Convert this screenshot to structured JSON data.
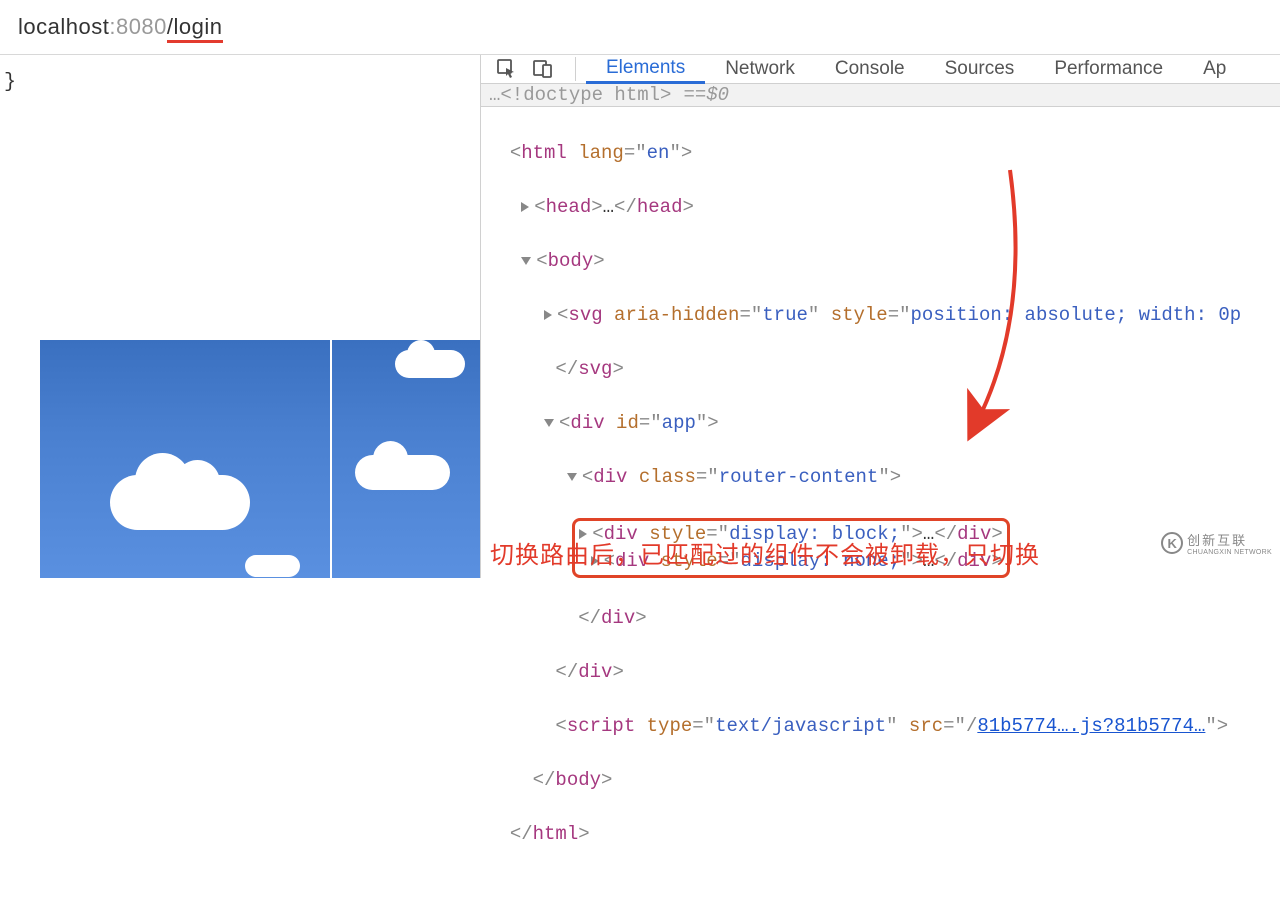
{
  "url": {
    "host": "localhost",
    "port": ":8080",
    "path": "/login"
  },
  "left": {
    "bracket": "}"
  },
  "tabs": {
    "elements": "Elements",
    "network": "Network",
    "console": "Console",
    "sources": "Sources",
    "performance": "Performance",
    "app_cut": "Ap"
  },
  "breadcrumb": {
    "ellipsis": "…",
    "doctype": "<!doctype html>",
    "eq": " == ",
    "dollar": "$0"
  },
  "dom": {
    "html_open": "<",
    "html_tag": "html",
    "html_attr": " lang",
    "html_eq": "=\"",
    "html_val": "en",
    "html_close": "\">",
    "head_open": "<",
    "head_tag": "head",
    "head_gt": ">",
    "head_ell": "…",
    "head_end": "</head>",
    "body_open": "<",
    "body_tag": "body",
    "body_gt": ">",
    "svg_open": "<",
    "svg_tag": "svg",
    "svg_attr1": " aria-hidden",
    "svg_eq1": "=\"",
    "svg_val1": "true",
    "svg_close1": "\"",
    "svg_attr2": " style",
    "svg_eq2": "=\"",
    "svg_val2": "position: absolute; width: 0p",
    "svg_dots": "",
    "svg_end_open": "</",
    "svg_end": "svg",
    "svg_end_gt": ">",
    "app_open": "<",
    "app_tag": "div",
    "app_attr": " id",
    "app_eq": "=\"",
    "app_val": "app",
    "app_close": "\">",
    "rc_open": "<",
    "rc_tag": "div",
    "rc_attr": " class",
    "rc_eq": "=\"",
    "rc_val": "router-content",
    "rc_close": "\">",
    "d1_open": "<",
    "d1_tag": "div",
    "d1_attr": " style",
    "d1_eq": "=\"",
    "d1_val": "display: block;",
    "d1_close": "\">",
    "d1_ell": "…",
    "d1_end": "</div>",
    "d2_open": "<",
    "d2_tag": "div",
    "d2_attr": " style",
    "d2_eq": "=\"",
    "d2_val": "display: none;",
    "d2_close": "\">",
    "d2_ell": "…",
    "d2_end": "</div>",
    "rc_end": "</div>",
    "app_end": "</div>",
    "script_open": "<",
    "script_tag": "script",
    "script_attr1": " type",
    "script_eq1": "=\"",
    "script_val1": "text/javascript",
    "script_close1": "\"",
    "script_attr2": " src",
    "script_eq2": "=\"",
    "script_src": "81b5774….js?81b5774…",
    "script_close2": "\">",
    "body_end": "</body>",
    "html_end": "</html>"
  },
  "annotation": "切换路由后，已匹配过的组件不会被卸载，只切换",
  "watermark": {
    "logo": "K",
    "line1": "创新互联",
    "line2": "CHUANGXIN NETWORK"
  }
}
